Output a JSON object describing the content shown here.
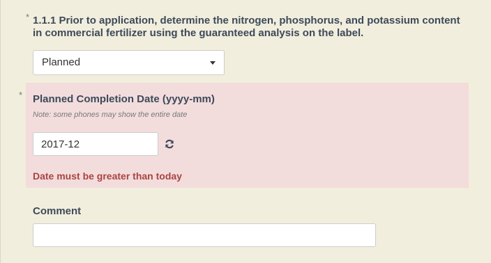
{
  "question": {
    "required_marker": "*",
    "text": "1.1.1 Prior to application, determine the nitrogen, phosphorus, and potassium content in commercial fertilizer using the guaranteed analysis on the label."
  },
  "status_select": {
    "selected": "Planned"
  },
  "completion_date": {
    "required_marker": "*",
    "label": "Planned Completion Date (yyyy-mm)",
    "note": "Note: some phones may show the entire date",
    "value": "2017-12",
    "error": "Date must be greater than today"
  },
  "comment": {
    "label": "Comment",
    "value": ""
  },
  "colors": {
    "background": "#f2eedd",
    "error_panel": "#f3dcdc",
    "error_text": "#a94442",
    "label_text": "#3c4a5a"
  },
  "icons": {
    "refresh": "refresh-icon",
    "dropdown": "chevron-down-icon"
  }
}
